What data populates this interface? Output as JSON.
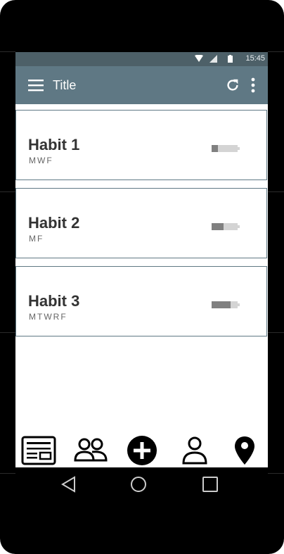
{
  "status_bar": {
    "time": "15:45",
    "icons": [
      "wifi-icon",
      "signal-icon",
      "battery-icon"
    ]
  },
  "app_bar": {
    "title": "Title",
    "icons": [
      "menu-icon",
      "refresh-icon",
      "more-vert-icon"
    ]
  },
  "habits": [
    {
      "name": "Habit 1",
      "days": "MWF",
      "progress": 0.25
    },
    {
      "name": "Habit 2",
      "days": "MF",
      "progress": 0.45
    },
    {
      "name": "Habit 3",
      "days": "MTWRF",
      "progress": 0.72
    }
  ],
  "bottom_nav": {
    "items": [
      "feed-icon",
      "group-icon",
      "add-circle-icon",
      "person-icon",
      "location-pin-icon"
    ]
  },
  "system_nav": {
    "buttons": [
      "back-icon",
      "home-icon",
      "recents-icon"
    ]
  },
  "colors": {
    "status_bar": "#4d6068",
    "app_bar": "#5f7884",
    "card_border": "#5f7884",
    "progress_fill": "#808080",
    "progress_track": "#d4d4d4"
  }
}
